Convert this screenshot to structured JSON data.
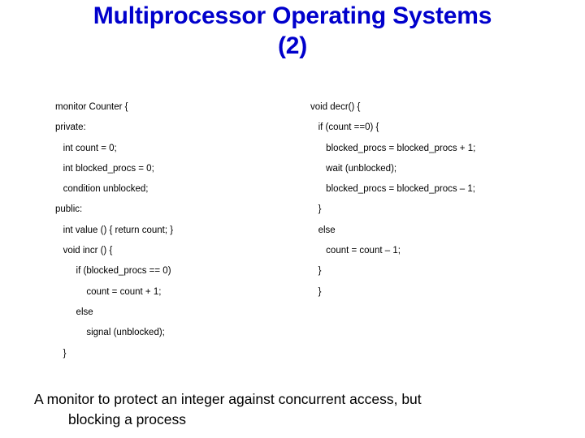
{
  "slide": {
    "title": "Multiprocessor Operating Systems (2)",
    "title_line1": "Multiprocessor Operating Systems",
    "title_line2": "(2)",
    "title_color": "#0000cc",
    "code_left": [
      "monitor Counter {",
      "private:",
      "   int count = 0;",
      "   int blocked_procs = 0;",
      "   condition unblocked;",
      "public:",
      "   int value () { return count; }",
      "   void incr () {",
      "        if (blocked_procs == 0)",
      "            count = count + 1;",
      "        else",
      "            signal (unblocked);",
      "   }"
    ],
    "code_right": [
      "void decr() {",
      "   if (count ==0) {",
      "      blocked_procs = blocked_procs + 1;",
      "      wait (unblocked);",
      "      blocked_procs = blocked_procs – 1;",
      "   }",
      "   else",
      "      count = count – 1;",
      "   }",
      "   }"
    ],
    "caption_line1": "A monitor to protect an integer against concurrent access, but",
    "caption_line2": "blocking a process"
  }
}
